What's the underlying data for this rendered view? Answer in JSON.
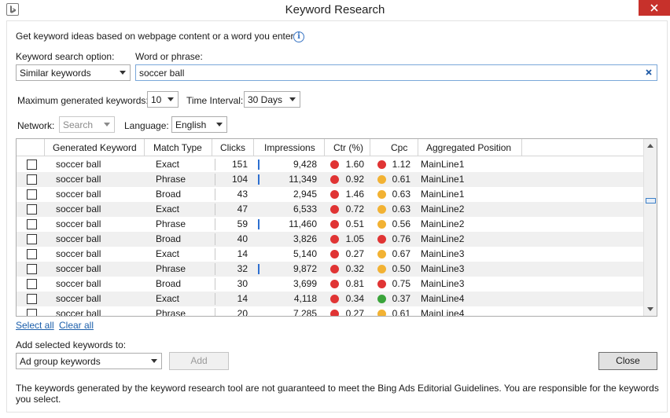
{
  "window": {
    "title": "Keyword Research"
  },
  "intro": {
    "text": "Get keyword ideas based on webpage content or a word you enter"
  },
  "search_option": {
    "label": "Keyword search option:",
    "value": "Similar keywords"
  },
  "phrase": {
    "label": "Word or phrase:",
    "value": "soccer ball"
  },
  "max_keywords": {
    "label": "Maximum generated keywords:",
    "value": "10"
  },
  "interval": {
    "label": "Time Interval:",
    "value": "30 Days"
  },
  "network": {
    "label": "Network:",
    "value": "Search"
  },
  "language": {
    "label": "Language:",
    "value": "English"
  },
  "columns": [
    "Generated Keyword",
    "Match Type",
    "Clicks",
    "Impressions",
    "Ctr (%)",
    "Cpc",
    "Aggregated Position"
  ],
  "colors": {
    "red": "#e03434",
    "orange": "#f2b233",
    "green": "#3aa43a",
    "bar": "#2d6fd0"
  },
  "rows": [
    {
      "keyword": "soccer ball",
      "match": "Exact",
      "clicks": "151",
      "impressions": "9,428",
      "ctr": "1.60",
      "ctr_color": "red",
      "cpc": "1.12",
      "cpc_color": "red",
      "position": "MainLine1",
      "bar": true
    },
    {
      "keyword": "soccer ball",
      "match": "Phrase",
      "clicks": "104",
      "impressions": "11,349",
      "ctr": "0.92",
      "ctr_color": "red",
      "cpc": "0.61",
      "cpc_color": "orange",
      "position": "MainLine1",
      "bar": true
    },
    {
      "keyword": "soccer ball",
      "match": "Broad",
      "clicks": "43",
      "impressions": "2,945",
      "ctr": "1.46",
      "ctr_color": "red",
      "cpc": "0.63",
      "cpc_color": "orange",
      "position": "MainLine1",
      "bar": false
    },
    {
      "keyword": "soccer ball",
      "match": "Exact",
      "clicks": "47",
      "impressions": "6,533",
      "ctr": "0.72",
      "ctr_color": "red",
      "cpc": "0.63",
      "cpc_color": "orange",
      "position": "MainLine2",
      "bar": false
    },
    {
      "keyword": "soccer ball",
      "match": "Phrase",
      "clicks": "59",
      "impressions": "11,460",
      "ctr": "0.51",
      "ctr_color": "red",
      "cpc": "0.56",
      "cpc_color": "orange",
      "position": "MainLine2",
      "bar": true
    },
    {
      "keyword": "soccer ball",
      "match": "Broad",
      "clicks": "40",
      "impressions": "3,826",
      "ctr": "1.05",
      "ctr_color": "red",
      "cpc": "0.76",
      "cpc_color": "red",
      "position": "MainLine2",
      "bar": false
    },
    {
      "keyword": "soccer ball",
      "match": "Exact",
      "clicks": "14",
      "impressions": "5,140",
      "ctr": "0.27",
      "ctr_color": "red",
      "cpc": "0.67",
      "cpc_color": "orange",
      "position": "MainLine3",
      "bar": false
    },
    {
      "keyword": "soccer ball",
      "match": "Phrase",
      "clicks": "32",
      "impressions": "9,872",
      "ctr": "0.32",
      "ctr_color": "red",
      "cpc": "0.50",
      "cpc_color": "orange",
      "position": "MainLine3",
      "bar": true
    },
    {
      "keyword": "soccer ball",
      "match": "Broad",
      "clicks": "30",
      "impressions": "3,699",
      "ctr": "0.81",
      "ctr_color": "red",
      "cpc": "0.75",
      "cpc_color": "red",
      "position": "MainLine3",
      "bar": false
    },
    {
      "keyword": "soccer ball",
      "match": "Exact",
      "clicks": "14",
      "impressions": "4,118",
      "ctr": "0.34",
      "ctr_color": "red",
      "cpc": "0.37",
      "cpc_color": "green",
      "position": "MainLine4",
      "bar": false
    },
    {
      "keyword": "soccer ball",
      "match": "Phrase",
      "clicks": "20",
      "impressions": "7,285",
      "ctr": "0.27",
      "ctr_color": "red",
      "cpc": "0.61",
      "cpc_color": "orange",
      "position": "MainLine4",
      "bar": false
    }
  ],
  "links": {
    "select_all": "Select all",
    "clear_all": "Clear all"
  },
  "add_to": {
    "label": "Add selected keywords to:",
    "value": "Ad group keywords",
    "add_label": "Add"
  },
  "close_label": "Close",
  "footer": "The keywords generated by the keyword research tool are not guaranteed to meet the Bing Ads Editorial Guidelines. You are responsible for the keywords you select."
}
